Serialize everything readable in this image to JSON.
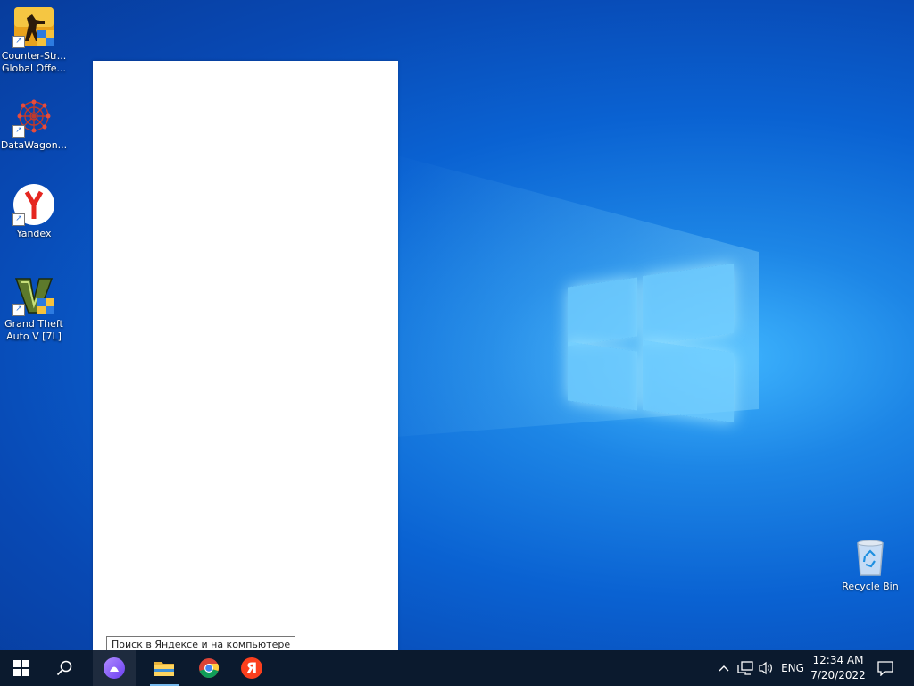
{
  "desktop": {
    "icons": [
      {
        "label": "Counter-Str... Global Offe...",
        "icon": "counter-strike-icon"
      },
      {
        "label": "DataWagon...",
        "icon": "datawagon-icon"
      },
      {
        "label": "Yandex",
        "icon": "yandex-browser-icon"
      },
      {
        "label": "Grand Theft Auto V [7L]",
        "icon": "gta-v-icon"
      }
    ],
    "recycle_bin": {
      "label": "Recycle Bin",
      "icon": "recycle-bin-icon"
    }
  },
  "tooltip": {
    "text": "Поиск в Яндексе и на компьютере"
  },
  "taskbar": {
    "buttons": [
      {
        "name": "start",
        "icon": "windows-start-icon"
      },
      {
        "name": "search",
        "icon": "search-icon"
      },
      {
        "name": "alice",
        "icon": "yandex-alice-icon",
        "active": true
      },
      {
        "name": "file-explorer",
        "icon": "folder-icon",
        "open": true
      },
      {
        "name": "chrome",
        "icon": "chrome-icon"
      },
      {
        "name": "yandex",
        "icon": "yandex-icon",
        "glyph": "Я"
      }
    ],
    "tray": {
      "chevron": "^",
      "language": "ENG",
      "time": "12:34 AM",
      "date": "7/20/2022"
    }
  },
  "colors": {
    "taskbar": "#0b1a2e",
    "accent": "#76b9ed",
    "alice": "#8a5cf6",
    "yandex_red": "#fc3f1d"
  }
}
